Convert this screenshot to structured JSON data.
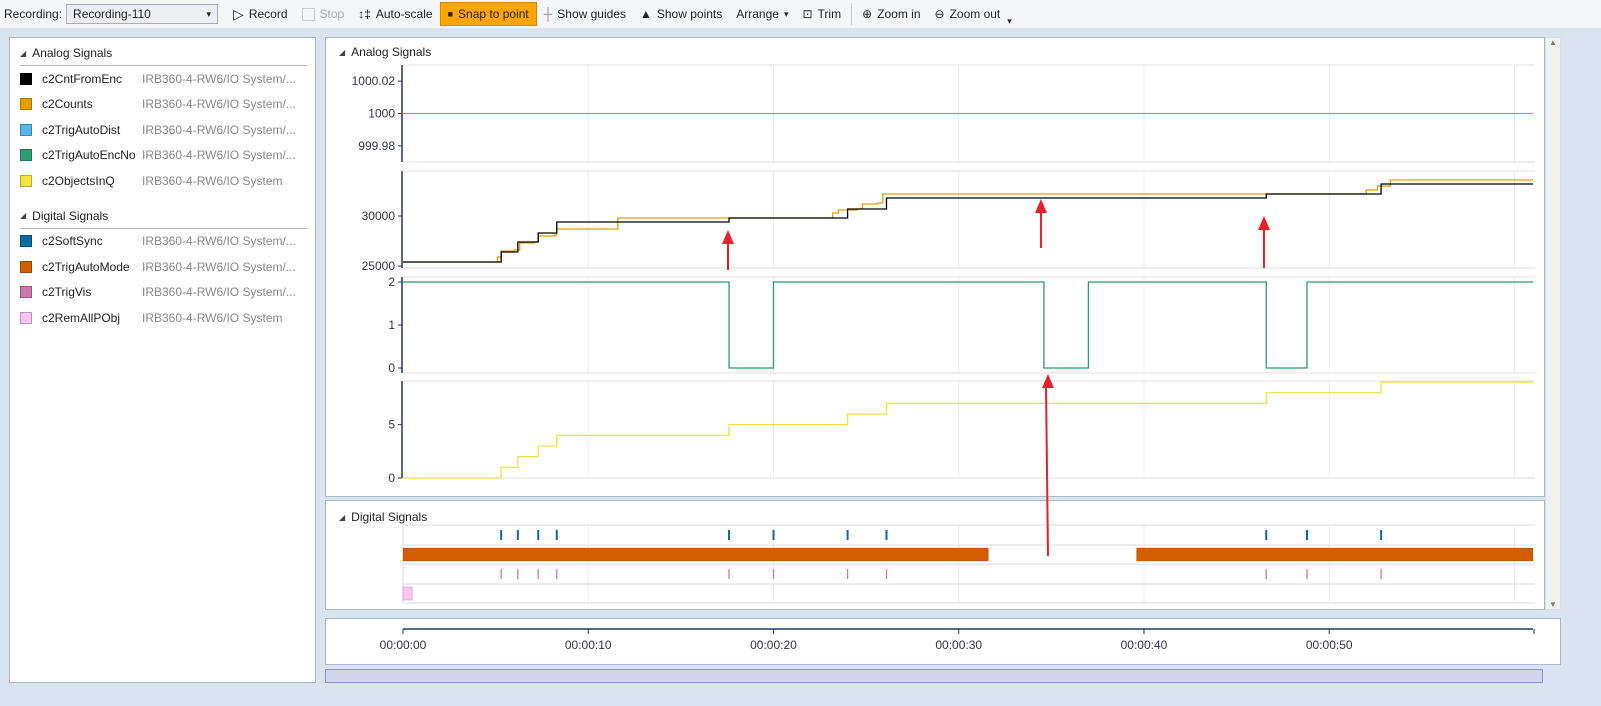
{
  "toolbar": {
    "recording_label": "Recording:",
    "recording_value": "Recording-110",
    "record": "Record",
    "stop": "Stop",
    "autoscale": "Auto-scale",
    "snap": "Snap to point",
    "guides": "Show guides",
    "points": "Show points",
    "arrange": "Arrange",
    "trim": "Trim",
    "zoom_in": "Zoom in",
    "zoom_out": "Zoom out"
  },
  "legend": {
    "analog_title": "Analog Signals",
    "digital_title": "Digital Signals",
    "analog": [
      {
        "name": "c2CntFromEnc",
        "source": "IRB360-4-RW6/IO System/...",
        "color": "#000000"
      },
      {
        "name": "c2Counts",
        "source": "IRB360-4-RW6/IO System/...",
        "color": "#e69f00"
      },
      {
        "name": "c2TrigAutoDist",
        "source": "IRB360-4-RW6/IO System/...",
        "color": "#56b4e9"
      },
      {
        "name": "c2TrigAutoEncNo",
        "source": "IRB360-4-RW6/IO System/...",
        "color": "#2a9d72"
      },
      {
        "name": "c2ObjectsInQ",
        "source": "IRB360-4-RW6/IO System",
        "color": "#f0e442"
      }
    ],
    "digital": [
      {
        "name": "c2SoftSync",
        "source": "IRB360-4-RW6/IO System/...",
        "color": "#0a6aa8"
      },
      {
        "name": "c2TrigAutoMode",
        "source": "IRB360-4-RW6/IO System/...",
        "color": "#d55e00"
      },
      {
        "name": "c2TrigVis",
        "source": "IRB360-4-RW6/IO System/...",
        "color": "#cc79a7"
      },
      {
        "name": "c2RemAllPObj",
        "source": "IRB360-4-RW6/IO System",
        "color": "#ffc4f4"
      }
    ]
  },
  "charts": {
    "analog_title": "Analog Signals",
    "digital_title": "Digital Signals"
  },
  "chart_data": [
    {
      "type": "line",
      "step": true,
      "ylim": [
        999.97,
        1000.03
      ],
      "yticks": [
        "1000.02",
        "1000",
        "999.98"
      ],
      "ytick_values": [
        1000.02,
        1000,
        999.98
      ],
      "series": [
        {
          "signal": "c2TrigAutoDist",
          "color": "#56b4e9",
          "points": [
            [
              0,
              1000
            ],
            [
              61,
              1000
            ]
          ]
        }
      ]
    },
    {
      "type": "line",
      "step": true,
      "ylim": [
        24800,
        34500
      ],
      "yticks": [
        "30000",
        "25000"
      ],
      "ytick_values": [
        30000,
        25000
      ],
      "series": [
        {
          "signal": "c2Counts",
          "color": "#e69f00",
          "points": [
            [
              0,
              25400
            ],
            [
              4.9,
              25400
            ],
            [
              5.1,
              25900
            ],
            [
              5.3,
              26500
            ],
            [
              6.0,
              26600
            ],
            [
              6.3,
              27300
            ],
            [
              7.1,
              27400
            ],
            [
              7.3,
              28000
            ],
            [
              8.2,
              28100
            ],
            [
              8.3,
              28700
            ],
            [
              11.4,
              28700
            ],
            [
              11.6,
              29800
            ],
            [
              22.9,
              29800
            ],
            [
              23.2,
              30300
            ],
            [
              23.5,
              30600
            ],
            [
              24.5,
              30700
            ],
            [
              24.8,
              31200
            ],
            [
              25.6,
              31300
            ],
            [
              25.9,
              32200
            ],
            [
              51.6,
              32200
            ],
            [
              52.0,
              32600
            ],
            [
              52.6,
              33000
            ],
            [
              53.3,
              33600
            ],
            [
              61,
              33600
            ]
          ]
        },
        {
          "signal": "c2CntFromEnc",
          "color": "#000000",
          "points": [
            [
              0,
              25400
            ],
            [
              5.3,
              26400
            ],
            [
              6.2,
              27400
            ],
            [
              7.3,
              28300
            ],
            [
              8.3,
              29400
            ],
            [
              17.6,
              29800
            ],
            [
              24.0,
              30700
            ],
            [
              26.1,
              31800
            ],
            [
              46.6,
              32200
            ],
            [
              52.8,
              33200
            ],
            [
              61,
              33200
            ]
          ]
        }
      ]
    },
    {
      "type": "line",
      "step": true,
      "ylim": [
        0,
        2
      ],
      "yticks": [
        "2",
        "1",
        "0"
      ],
      "ytick_values": [
        2,
        1,
        0
      ],
      "series": [
        {
          "signal": "c2TrigAutoEncNo",
          "color": "#2a9d72",
          "points": [
            [
              0,
              2
            ],
            [
              17.6,
              0
            ],
            [
              20.0,
              2
            ],
            [
              34.6,
              0
            ],
            [
              37.0,
              2
            ],
            [
              46.6,
              0
            ],
            [
              48.8,
              2
            ],
            [
              61,
              2
            ]
          ]
        }
      ]
    },
    {
      "type": "line",
      "step": true,
      "ylim": [
        0,
        9.1
      ],
      "yticks": [
        "5",
        "0"
      ],
      "ytick_values": [
        5,
        0
      ],
      "series": [
        {
          "signal": "c2ObjectsInQ",
          "color": "#f0e442",
          "points": [
            [
              0,
              0
            ],
            [
              5.3,
              1
            ],
            [
              6.2,
              2
            ],
            [
              7.3,
              3
            ],
            [
              8.3,
              4
            ],
            [
              17.6,
              5
            ],
            [
              24.0,
              6
            ],
            [
              26.1,
              7
            ],
            [
              46.6,
              8
            ],
            [
              52.8,
              9
            ],
            [
              61,
              9
            ]
          ]
        }
      ]
    },
    {
      "type": "digital",
      "rows": [
        {
          "signal": "c2SoftSync",
          "kind": "pulses",
          "color": "#0a6aa8",
          "times": [
            5.3,
            6.2,
            7.3,
            8.3,
            17.6,
            20.0,
            24.0,
            26.1,
            46.6,
            48.8,
            52.8
          ]
        },
        {
          "signal": "c2TrigAutoMode",
          "kind": "high",
          "color": "#d55e00",
          "intervals": [
            [
              0,
              31.6
            ],
            [
              39.6,
              61
            ]
          ]
        },
        {
          "signal": "c2TrigVis",
          "kind": "pulses",
          "color": "#cc79a7",
          "times": [
            5.3,
            6.2,
            7.3,
            8.3,
            17.6,
            20.0,
            24.0,
            26.1,
            46.6,
            48.8,
            52.8
          ]
        },
        {
          "signal": "c2RemAllPObj",
          "kind": "high",
          "color": "#ffc4f4",
          "intervals": [
            [
              0,
              0.5
            ]
          ]
        }
      ]
    },
    {
      "type": "time-axis",
      "xlim": [
        0,
        61
      ],
      "xticks": [
        "00:00:00",
        "00:00:10",
        "00:00:20",
        "00:00:30",
        "00:00:40",
        "00:00:50"
      ],
      "xtick_values": [
        0,
        10,
        20,
        30,
        40,
        50
      ]
    }
  ]
}
